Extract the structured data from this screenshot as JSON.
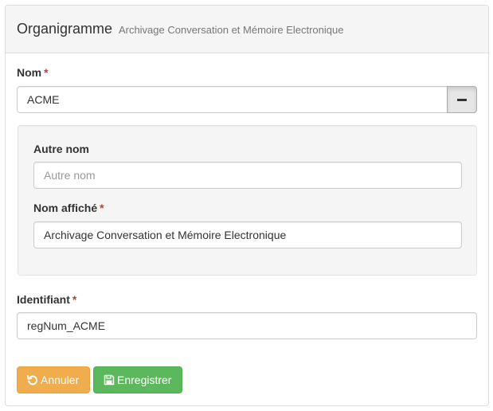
{
  "header": {
    "title": "Organigramme",
    "subtitle": "Archivage Conversation et Mémoire Electronique"
  },
  "form": {
    "required_marker": "*",
    "nom": {
      "label": "Nom",
      "value": "ACME"
    },
    "autre_nom": {
      "label": "Autre nom",
      "value": "",
      "placeholder": "Autre nom"
    },
    "nom_affiche": {
      "label": "Nom affiché",
      "value": "Archivage Conversation et Mémoire Electronique"
    },
    "identifiant": {
      "label": "Identifiant",
      "value": "regNum_ACME"
    }
  },
  "actions": {
    "cancel_label": "Annuler",
    "save_label": "Enregistrer"
  },
  "icons": {
    "remove": "minus-icon",
    "cancel": "undo-icon",
    "save": "floppy-disk-icon"
  },
  "colors": {
    "required": "#a94442",
    "cancel_button": "#f0ad4e",
    "save_button": "#5cb85c"
  }
}
